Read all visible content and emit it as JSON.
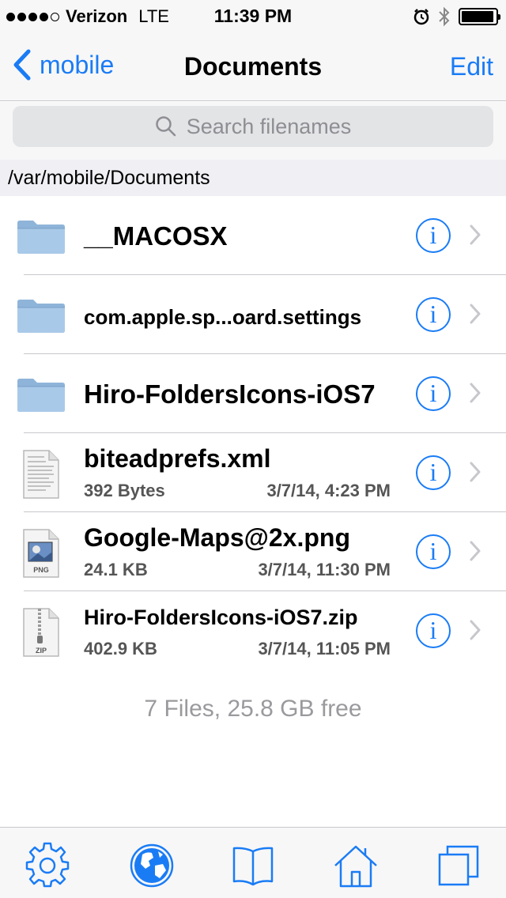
{
  "status_bar": {
    "carrier": "Verizon",
    "network": "LTE",
    "time": "11:39 PM",
    "signal_bars": 4,
    "battery_level": 0.95
  },
  "nav": {
    "back_label": "mobile",
    "title": "Documents",
    "edit_label": "Edit"
  },
  "search": {
    "placeholder": "Search filenames"
  },
  "path": "/var/mobile/Documents",
  "files": [
    {
      "name": "__MACOSX",
      "type": "folder"
    },
    {
      "name": "com.apple.sp...oard.settings",
      "type": "folder"
    },
    {
      "name": "Hiro-FoldersIcons-iOS7",
      "type": "folder"
    },
    {
      "name": "biteadprefs.xml",
      "type": "xml",
      "size": "392 Bytes",
      "date": "3/7/14, 4:23 PM"
    },
    {
      "name": "Google-Maps@2x.png",
      "type": "png",
      "size": "24.1 KB",
      "date": "3/7/14, 11:30 PM",
      "badge": "PNG"
    },
    {
      "name": "Hiro-FoldersIcons-iOS7.zip",
      "type": "zip",
      "size": "402.9 KB",
      "date": "3/7/14, 11:05 PM",
      "badge": "ZIP"
    }
  ],
  "info_glyph": "i",
  "summary": "7 Files, 25.8 GB free",
  "tabs": [
    {
      "icon": "gear-icon"
    },
    {
      "icon": "globe-icon"
    },
    {
      "icon": "book-icon"
    },
    {
      "icon": "home-icon"
    },
    {
      "icon": "windows-icon"
    }
  ],
  "colors": {
    "accent": "#1a7cf5",
    "folder": "#8fb4d9",
    "secondary_text": "#555555"
  }
}
